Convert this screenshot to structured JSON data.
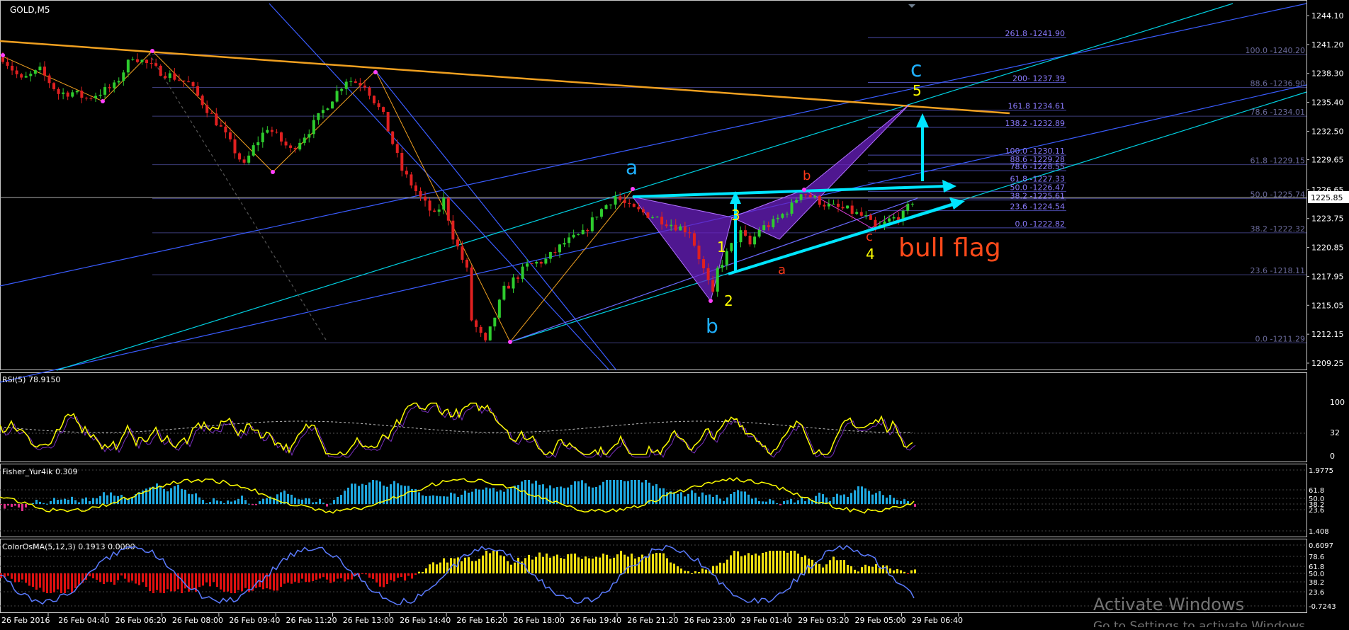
{
  "window": {
    "symbol_label": "GOLD,M5"
  },
  "colors": {
    "background": "#000000",
    "up_candle": "#2ecc2e",
    "down_candle": "#e02020",
    "orange_trend": "#f0a020",
    "cyan": "#00e5ff",
    "blue_channel": "#3a5cff",
    "purple": "#7b2fc8",
    "yellow": "#ffff00",
    "pink_hist": "#e0308a",
    "blue_hist": "#1fa8e0",
    "red_hist": "#e01010",
    "osma_line": "#5b7bff",
    "axis_text": "#ffffff",
    "fib_text": "#8b7bff",
    "bull_flag_text": "#ff4a1a"
  },
  "price_axis": {
    "labels": [
      "1244.10",
      "1241.20",
      "1238.30",
      "1235.40",
      "1232.50",
      "1229.65",
      "1226.65",
      "1223.75",
      "1220.85",
      "1217.95",
      "1215.05",
      "1212.15",
      "1209.25"
    ],
    "current_price": "1225.85",
    "ylim": [
      1207.7,
      1245.2
    ]
  },
  "time_axis": {
    "labels": [
      "26 Feb 2016",
      "26 Feb 04:40",
      "26 Feb 06:20",
      "26 Feb 08:00",
      "26 Feb 09:40",
      "26 Feb 11:20",
      "26 Feb 13:00",
      "26 Feb 14:40",
      "26 Feb 16:20",
      "26 Feb 18:00",
      "26 Feb 19:40",
      "26 Feb 21:20",
      "26 Feb 23:00",
      "29 Feb 01:40",
      "29 Feb 03:20",
      "29 Feb 05:00",
      "29 Feb 06:40"
    ]
  },
  "fib_left": [
    {
      "text": "261.8 -1241.90",
      "price": 1241.9
    },
    {
      "text": "200- 1237.39",
      "price": 1237.39
    },
    {
      "text": "161.8 1234.61",
      "price": 1234.61
    },
    {
      "text": "138.2 -1232.89",
      "price": 1232.89
    },
    {
      "text": "100.0 -1230.11",
      "price": 1230.11
    },
    {
      "text": "88.6 -1229.28",
      "price": 1229.28
    },
    {
      "text": "78.6 -1228.55",
      "price": 1228.55
    },
    {
      "text": "61.8 -1227.33",
      "price": 1227.33
    },
    {
      "text": "50.0 -1226.47",
      "price": 1226.47
    },
    {
      "text": "38.2 -1225.61",
      "price": 1225.61
    },
    {
      "text": "23.6 -1224.54",
      "price": 1224.54
    },
    {
      "text": "0.0 -1222.82",
      "price": 1222.82
    }
  ],
  "fib_right": [
    {
      "text": "100.0 -1240.20",
      "price": 1240.2
    },
    {
      "text": "88.6 -1236.90",
      "price": 1236.9
    },
    {
      "text": "78.6 -1234.01",
      "price": 1234.01
    },
    {
      "text": "61.8 -1229.15",
      "price": 1229.15
    },
    {
      "text": "50.0 -1225.74",
      "price": 1225.74
    },
    {
      "text": "38.2 -1222.32",
      "price": 1222.32
    },
    {
      "text": "23.6 -1218.11",
      "price": 1218.11
    },
    {
      "text": "0.0 -1211.29",
      "price": 1211.29
    }
  ],
  "wave_labels": {
    "a_big": "a",
    "b_big": "b",
    "c_big": "c",
    "w1": "1",
    "w2": "2",
    "w3": "3",
    "w4": "4",
    "w5": "5",
    "a_small": "a",
    "b_small": "b",
    "c_small": "c",
    "bull_flag": "bull flag"
  },
  "rsi": {
    "label": "RSI(5) 78.9150",
    "levels": [
      "100",
      "32",
      "0"
    ]
  },
  "fisher": {
    "label": "Fisher_Yur4ik 0.309",
    "levels": [
      "1.9775",
      "61.8",
      "50.0",
      "38.2",
      "23.6",
      "1.408"
    ]
  },
  "osma": {
    "label": "ColorOsMA(5,12,3) 0.1913 0.0000",
    "levels": [
      "0.6097",
      "78.6",
      "61.8",
      "50.0",
      "38.2",
      "23.6",
      "-0.7243"
    ]
  },
  "watermark": {
    "line1": "Activate Windows",
    "line2": "Go to Settings to activate Windows."
  },
  "chart_data": {
    "type": "candlestick",
    "title": "GOLD,M5",
    "ylim": [
      1207.7,
      1245.2
    ],
    "price_path": [
      [
        0,
        1239.9
      ],
      [
        4,
        1237.6
      ],
      [
        8,
        1238.6
      ],
      [
        12,
        1236.3
      ],
      [
        15,
        1236.4
      ],
      [
        18,
        1235.8
      ],
      [
        24,
        1237.0
      ],
      [
        28,
        1240.1
      ],
      [
        33,
        1238.7
      ],
      [
        40,
        1237.3
      ],
      [
        47,
        1232.8
      ],
      [
        52,
        1229.0
      ],
      [
        54,
        1230.9
      ],
      [
        57,
        1232.9
      ],
      [
        62,
        1230.6
      ],
      [
        66,
        1232.6
      ],
      [
        70,
        1235.2
      ],
      [
        74,
        1237.7
      ],
      [
        78,
        1237.2
      ],
      [
        82,
        1234.0
      ],
      [
        86,
        1228.6
      ],
      [
        90,
        1225.8
      ],
      [
        93,
        1224.0
      ],
      [
        95,
        1225.6
      ],
      [
        97,
        1222.0
      ],
      [
        100,
        1218.5
      ],
      [
        101,
        1213.6
      ],
      [
        104,
        1211.2
      ],
      [
        108,
        1216.6
      ],
      [
        113,
        1219.0
      ],
      [
        117,
        1219.6
      ],
      [
        121,
        1221.3
      ],
      [
        125,
        1222.2
      ],
      [
        128,
        1224.2
      ],
      [
        132,
        1226.0
      ],
      [
        135,
        1224.8
      ],
      [
        140,
        1224.0
      ],
      [
        145,
        1223.0
      ],
      [
        148,
        1222.5
      ],
      [
        152,
        1217.3
      ],
      [
        153,
        1216.0
      ],
      [
        154,
        1218.6
      ],
      [
        157,
        1221.0
      ],
      [
        159,
        1222.3
      ],
      [
        161,
        1221.1
      ],
      [
        163,
        1222.7
      ],
      [
        166,
        1223.3
      ],
      [
        170,
        1225.0
      ],
      [
        172,
        1226.5
      ],
      [
        175,
        1225.7
      ],
      [
        178,
        1225.0
      ],
      [
        182,
        1224.6
      ],
      [
        186,
        1223.8
      ],
      [
        188,
        1222.6
      ],
      [
        191,
        1223.6
      ],
      [
        194,
        1224.1
      ],
      [
        196,
        1225.5
      ]
    ]
  }
}
